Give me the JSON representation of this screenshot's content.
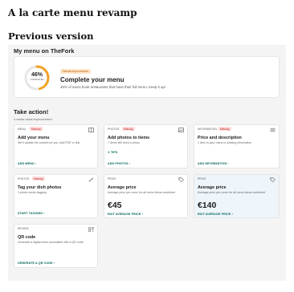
{
  "page": {
    "title": "A la carte menu revamp",
    "section_title": "Previous version"
  },
  "panel": {
    "heading": "My menu on TheFork",
    "complete": {
      "percent_text": "46%",
      "percent": 46,
      "gauge_label": "COMPLETED",
      "badge": "Needs improvement",
      "title": "Complete your menu",
      "description": "45% of users book restaurants that have their full menu. Keep it up!",
      "accent_color": "#f2a325",
      "track_color": "#e7e7e7"
    },
    "take_action": {
      "title": "Take action!",
      "subtitle": "4 areas need improvement"
    },
    "cards": [
      {
        "type": "MENU",
        "badge": "Missing",
        "icon": "menu-book-icon",
        "title": "Add your menu",
        "description": "We'll update the content for you. Add PDF or link",
        "link": "ADD MENU",
        "link_glyph": "›"
      },
      {
        "type": "PHOTOS",
        "badge": "Missing",
        "icon": "image-icon",
        "title": "Add photos to items",
        "description": "7 items still need a photo",
        "tips": "TIPS",
        "tips_glyph": "✦",
        "link": "ADD PHOTOS",
        "link_glyph": "›"
      },
      {
        "type": "INFORMATION",
        "badge": "Missing",
        "icon": "list-icon",
        "title": "Price and description",
        "description": "1 item in your menu is missing information",
        "link": "ADD INFORMATION",
        "link_glyph": "›"
      },
      {
        "type": "PHOTOS",
        "badge": "Missing",
        "icon": "pencil-icon",
        "title": "Tag your dish photos",
        "description": "1 photo needs tagging",
        "link": "START TAGGING",
        "link_glyph": "›"
      },
      {
        "type": "PRICE",
        "icon": "price-tag-icon",
        "title": "Average price",
        "description": "Average price per cover for all menu items combined",
        "price": "€45",
        "link": "EDIT AVERAGE PRICE",
        "link_glyph": "›"
      },
      {
        "type": "PRICE",
        "icon": "price-tag-icon",
        "title": "Average price",
        "description": "Average price per cover for all menu items combined",
        "price": "€140",
        "link": "EDIT AVERAGE PRICE",
        "link_glyph": "›"
      },
      {
        "type": "REVIEW",
        "icon": "qr-code-icon",
        "title": "QR code",
        "description": "Generate a digital menu accessible with a QR code",
        "link": "GENERATE A QR CODE",
        "link_glyph": "›"
      }
    ]
  },
  "colors": {
    "link": "#00665a",
    "missing_bg": "#fcdcdc",
    "missing_text": "#c62828",
    "highlight_bg": "#eef5fb"
  }
}
